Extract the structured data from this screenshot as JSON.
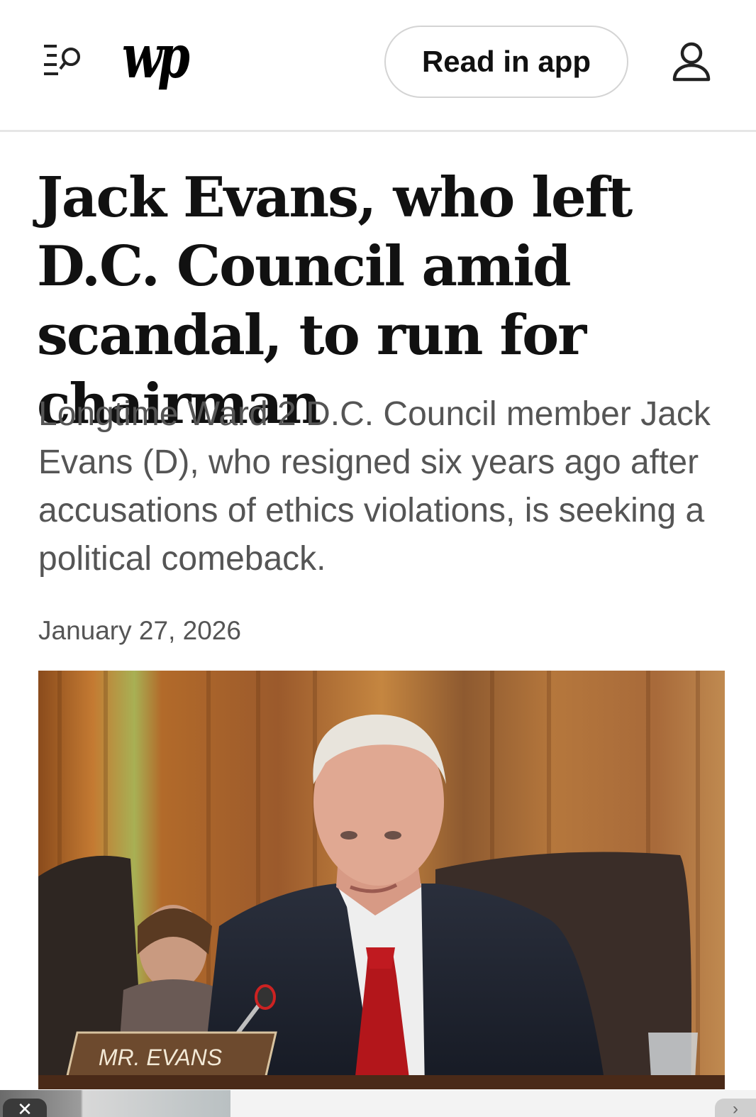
{
  "header": {
    "logo_text": "wp",
    "read_in_app_label": "Read in app",
    "menu_icon": "menu-search-icon",
    "account_icon": "account-icon"
  },
  "article": {
    "headline": "Jack Evans, who left D.C. Council amid scandal, to run for chairman",
    "dek": "Longtime Ward 2 D.C. Council member Jack Evans (D), who resigned six years ago after accusations of ethics violations, is seeking a political comeback.",
    "date": "January 27, 2026",
    "photo": {
      "nameplate_text": "MR. EVANS"
    }
  },
  "ad_bar": {
    "close_icon": "close-icon",
    "next_icon": "chevron-right-icon"
  },
  "colors": {
    "text": "#111111",
    "dek": "#555555",
    "divider": "#e6e6e6"
  }
}
